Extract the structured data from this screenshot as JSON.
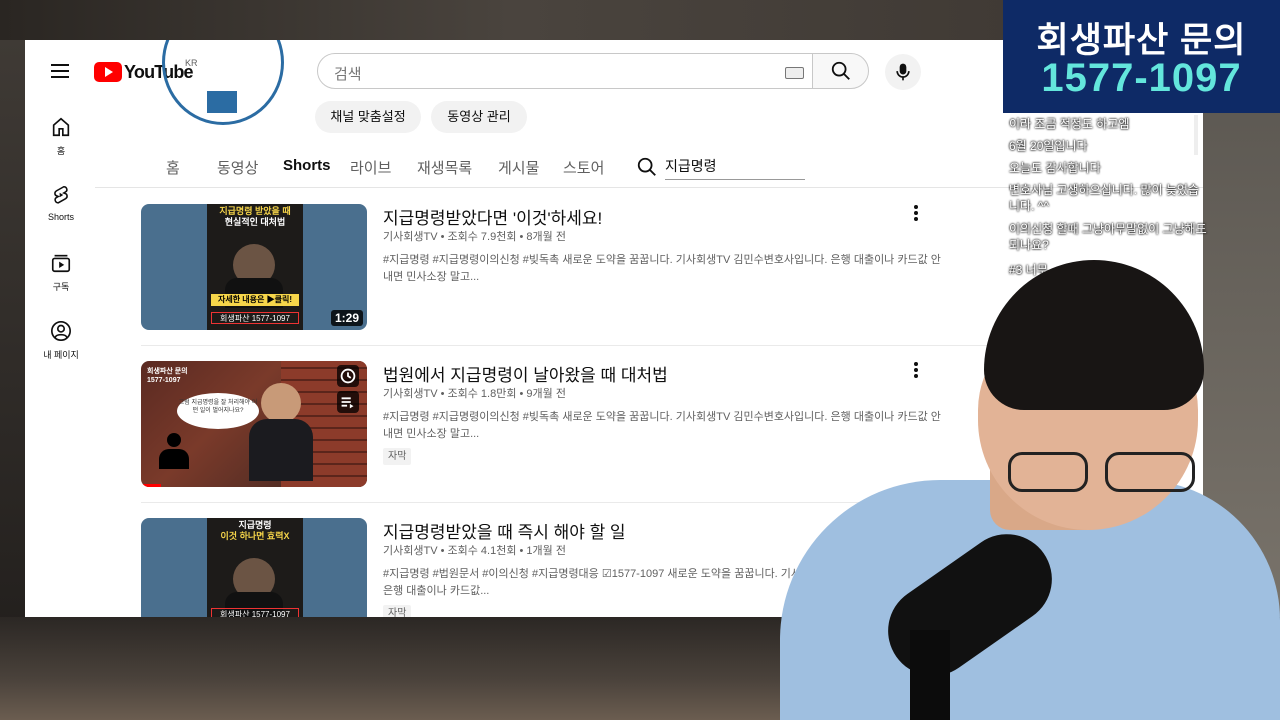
{
  "youtube": {
    "logo_text": "YouTube",
    "region": "KR",
    "search_placeholder": "검색",
    "chips": [
      "채널 맞춤설정",
      "동영상 관리"
    ],
    "tabs": [
      {
        "label": "홈",
        "active": false
      },
      {
        "label": "동영상",
        "active": false
      },
      {
        "label": "Shorts",
        "active": true
      },
      {
        "label": "라이브",
        "active": false
      },
      {
        "label": "재생목록",
        "active": false
      },
      {
        "label": "게시물",
        "active": false
      },
      {
        "label": "스토어",
        "active": false
      }
    ],
    "channel_search_value": "지급명령",
    "sidebar": [
      {
        "label": "홈",
        "icon": "home-icon"
      },
      {
        "label": "Shorts",
        "icon": "shorts-icon"
      },
      {
        "label": "구독",
        "icon": "subscriptions-icon"
      },
      {
        "label": "내 페이지",
        "icon": "you-icon"
      }
    ],
    "videos": [
      {
        "title": "지급명령받았다면 '이것'하세요!",
        "meta": "기사회생TV • 조회수 7.9천회 • 8개월 전",
        "desc": "#지급명령 #지급명령이의신청 #빚독촉 새로운 도약을 꿈꿉니다. 기사회생TV 김민수변호사입니다. 은행 대출이나 카드값 안 내면 민사소장 말고...",
        "duration": "1:29",
        "badge": "",
        "thumb_lines": [
          "지급명령 받았을 때",
          "현실적인 대처법"
        ],
        "thumb_bar": "자세한 내용은 ▶클릭!",
        "thumb_phone": "회생파산 1577-1097"
      },
      {
        "title": "법원에서 지급명령이 날아왔을 때 대처법",
        "meta": "기사회생TV • 조회수 1.8만회 • 9개월 전",
        "desc": "#지급명령 #지급명령이의신청 #빚독촉 새로운 도약을 꿈꿉니다. 기사회생TV 김민수변호사입니다. 은행 대출이나 카드값 안 내면 민사소장 말고...",
        "duration": "",
        "badge": "자막",
        "thumb_lines": [
          "회생파산 문의",
          "1577-1097"
        ],
        "thumb_bubble": "그럼 지급명령을 잘 처리해야 어떤 일이 벌어지나요?"
      },
      {
        "title": "지급명령받았을 때 즉시 해야 할 일",
        "meta": "기사회생TV • 조회수 4.1천회 • 1개월 전",
        "desc": "#지급명령 #법원문서 #이의신청 #지급명령대응 ☑1577-1097 새로운 도약을 꿈꿉니다. 기사회생TV 김민수변호사입니다. 은행 대출이나 카드값...",
        "duration": "",
        "badge": "자막",
        "thumb_lines": [
          "지급명령",
          "이것 하나면 효력X"
        ],
        "thumb_phone": "회생파산 1577-1097"
      }
    ]
  },
  "banner": {
    "line1": "회생파산 문의",
    "line2": "1577-1097"
  },
  "chat": [
    "이라 조금 적정도 하고엠",
    "6월 20일입니다",
    "오늘도 감사합니다",
    "변호사님 고생하으십니다. 많이 늦었습",
    "니다. ^^",
    "이의신청 할때 그냥아무말없이 그냥해도",
    "되나요?",
    "#3 너무 ..."
  ],
  "colors": {
    "yt_red": "#ff0000",
    "banner_bg": "#0e2a66",
    "banner_number": "#63e6dc"
  }
}
